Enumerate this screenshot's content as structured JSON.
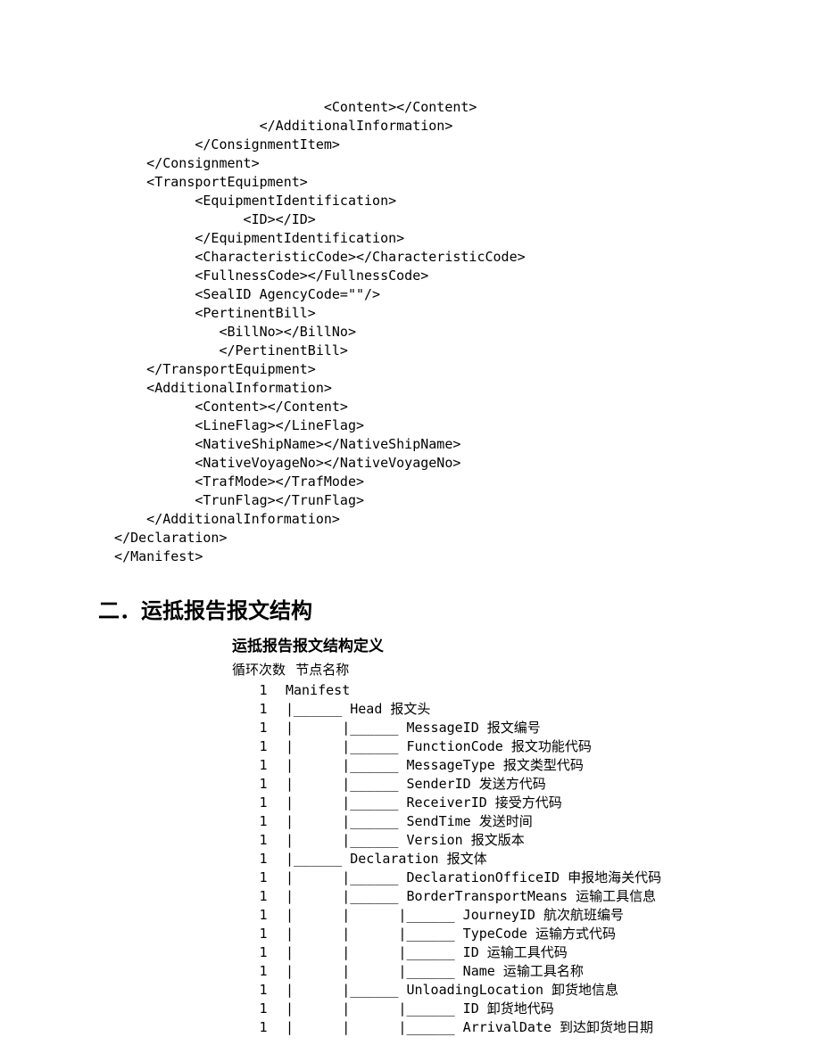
{
  "xml": {
    "lines": [
      "                            <Content></Content>",
      "                    </AdditionalInformation>",
      "            </ConsignmentItem>",
      "      </Consignment>",
      "      <TransportEquipment>",
      "            <EquipmentIdentification>",
      "                  <ID></ID>",
      "            </EquipmentIdentification>",
      "            <CharacteristicCode></CharacteristicCode>",
      "            <FullnessCode></FullnessCode>",
      "            <SealID AgencyCode=\"\"/>",
      "            <PertinentBill>",
      "               <BillNo></BillNo>",
      "               </PertinentBill>",
      "      </TransportEquipment>",
      "      <AdditionalInformation>",
      "            <Content></Content>",
      "            <LineFlag></LineFlag>",
      "            <NativeShipName></NativeShipName>",
      "            <NativeVoyageNo></NativeVoyageNo>",
      "            <TrafMode></TrafMode>",
      "            <TrunFlag></TrunFlag>",
      "      </AdditionalInformation>",
      "  </Declaration>",
      "  </Manifest>"
    ]
  },
  "section_title": "二．运抵报告报文结构",
  "sub_title": "运抵报告报文结构定义",
  "tree_header_left": "循环次数",
  "tree_header_right": "节点名称",
  "tree": [
    {
      "count": "1",
      "tree": "Manifest"
    },
    {
      "count": "1",
      "tree": "|______ Head 报文头"
    },
    {
      "count": "1",
      "tree": "|      |______ MessageID 报文编号"
    },
    {
      "count": "1",
      "tree": "|      |______ FunctionCode 报文功能代码"
    },
    {
      "count": "1",
      "tree": "|      |______ MessageType 报文类型代码"
    },
    {
      "count": "1",
      "tree": "|      |______ SenderID 发送方代码"
    },
    {
      "count": "1",
      "tree": "|      |______ ReceiverID 接受方代码"
    },
    {
      "count": "1",
      "tree": "|      |______ SendTime 发送时间"
    },
    {
      "count": "1",
      "tree": "|      |______ Version 报文版本"
    },
    {
      "count": "1",
      "tree": "|______ Declaration 报文体"
    },
    {
      "count": "1",
      "tree": "|      |______ DeclarationOfficeID 申报地海关代码"
    },
    {
      "count": "1",
      "tree": "|      |______ BorderTransportMeans 运输工具信息"
    },
    {
      "count": "1",
      "tree": "|      |      |______ JourneyID 航次航班编号"
    },
    {
      "count": "1",
      "tree": "|      |      |______ TypeCode 运输方式代码"
    },
    {
      "count": "1",
      "tree": "|      |      |______ ID 运输工具代码"
    },
    {
      "count": "1",
      "tree": "|      |      |______ Name 运输工具名称"
    },
    {
      "count": "1",
      "tree": "|      |______ UnloadingLocation 卸货地信息"
    },
    {
      "count": "1",
      "tree": "|      |      |______ ID 卸货地代码"
    },
    {
      "count": "1",
      "tree": "|      |      |______ ArrivalDate 到达卸货地日期"
    }
  ]
}
